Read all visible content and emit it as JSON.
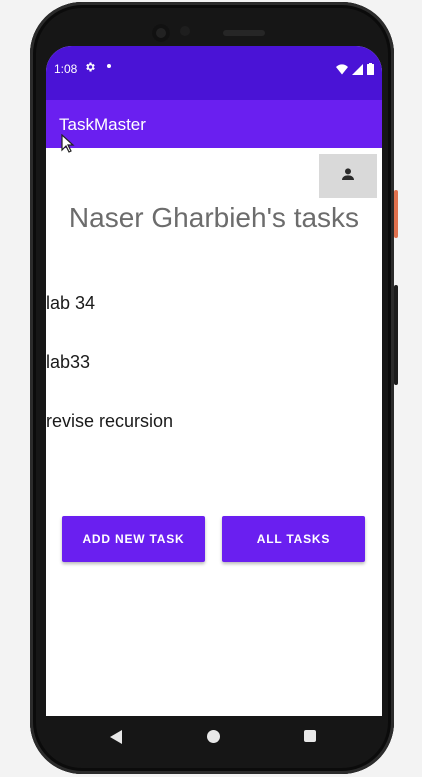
{
  "status_bar": {
    "time": "1:08",
    "icons": [
      "gear-icon",
      "dot-icon",
      "wifi-icon",
      "signal-icon",
      "battery-icon"
    ]
  },
  "app_bar": {
    "title": "TaskMaster",
    "color": "#6a1ff0"
  },
  "profile_button": {
    "icon": "person-icon"
  },
  "page": {
    "title": "Naser Gharbieh's tasks"
  },
  "tasks": [
    {
      "title": "lab 34"
    },
    {
      "title": "lab33"
    },
    {
      "title": "revise recursion"
    }
  ],
  "actions": {
    "add_new_task": "ADD NEW TASK",
    "all_tasks": "ALL TASKS"
  },
  "nav_bar": {
    "icons": [
      "back-icon",
      "home-icon",
      "recent-apps-icon"
    ]
  },
  "colors": {
    "status_bar": "#4a13d6",
    "accent": "#6a1ff0",
    "profile_button_bg": "#d9d9d9"
  }
}
